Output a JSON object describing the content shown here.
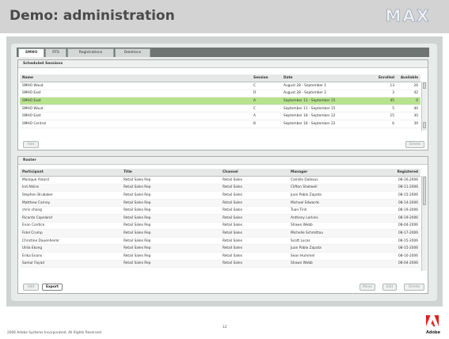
{
  "slide": {
    "title": "Demo: administration",
    "brand": "MAX",
    "footer": "2006 Adobe Systems Incorporated. All Rights Reserved.",
    "page_number": "12",
    "adobe_word": "Adobe",
    "colors": {
      "title_bar": "#d3d3d3",
      "selection": "#b7e28e",
      "adobe_red": "#e0201b"
    }
  },
  "tabs": [
    {
      "label": "SMHO",
      "active": true
    },
    {
      "label": "RTS",
      "active": false
    },
    {
      "label": "Registrations",
      "active": false
    },
    {
      "label": "Deletions",
      "active": false
    }
  ],
  "sessions": {
    "heading": "Scheduled Sessions",
    "columns": [
      "Name",
      "Session",
      "Date",
      "Enrolled",
      "Available"
    ],
    "rows": [
      {
        "name": "SMHO Waud",
        "session": "C",
        "date": "August 28 - September 1",
        "enrolled": "13",
        "available": "26"
      },
      {
        "name": "SMHO East",
        "session": "D",
        "date": "August 28 - September 2",
        "enrolled": "3",
        "available": "42"
      },
      {
        "name": "SMHO East",
        "session": "A",
        "date": "September 11 - September 15",
        "enrolled": "45",
        "available": "0"
      },
      {
        "name": "SMHO Waud",
        "session": "C",
        "date": "September 11 - September 15",
        "enrolled": "5",
        "available": "40"
      },
      {
        "name": "SMHO East",
        "session": "A",
        "date": "September 18 - September 22",
        "enrolled": "15",
        "available": "30"
      },
      {
        "name": "SMHO Central",
        "session": "B",
        "date": "September 18 - September 22",
        "enrolled": "6",
        "available": "39"
      }
    ],
    "selected_index": 2,
    "add_label": "Add",
    "delete_label": "Delete"
  },
  "roster": {
    "heading": "Roster",
    "columns": [
      "Participant",
      "Title",
      "Channel",
      "Manager",
      "Registered"
    ],
    "rows": [
      {
        "participant": "Monique Arkord",
        "title": "Retail Sales Rep",
        "channel": "Retail Sales",
        "manager": "Camille Dalexus",
        "registered": "08-16-2006"
      },
      {
        "participant": "Ind Atkins",
        "title": "Retail Sales Rep",
        "channel": "Retail Sales",
        "manager": "Clifton Shotwell",
        "registered": "08-11-2006"
      },
      {
        "participant": "Stephen Brubaker",
        "title": "Retail Sales Rep",
        "channel": "Retail Sales",
        "manager": "Juan Pablo Zapata",
        "registered": "08-15-2006"
      },
      {
        "participant": "Matthew Carney",
        "title": "Retail Sales Rep",
        "channel": "Retail Sales",
        "manager": "Michael Edwards",
        "registered": "08-14-2006"
      },
      {
        "participant": "chris chong",
        "title": "Retail Sales Rep",
        "channel": "Retail Sales",
        "manager": "Tuan Tinh",
        "registered": "08-19-2006"
      },
      {
        "participant": "Ricardo Copeland",
        "title": "Retail Sales Rep",
        "channel": "Retail Sales",
        "manager": "Anthony Larkins",
        "registered": "08-19-2006"
      },
      {
        "participant": "Evan Cordice",
        "title": "Retail Sales Rep",
        "channel": "Retail Sales",
        "manager": "Shawn Webb",
        "registered": "08-04-2006"
      },
      {
        "participant": "Fidel Crump",
        "title": "Retail Sales Rep",
        "channel": "Retail Sales",
        "manager": "Michelle Schmittou",
        "registered": "08-17-2006"
      },
      {
        "participant": "Christine Dauenheimr",
        "title": "Retail Sales Rep",
        "channel": "Retail Sales",
        "manager": "Scott Lucas",
        "registered": "08-15-2006"
      },
      {
        "participant": "Ulilia Ekong",
        "title": "Retail Sales Rep",
        "channel": "Retail Sales",
        "manager": "Juan Pablo Zapata",
        "registered": "08-15-2006"
      },
      {
        "participant": "Erika Evans",
        "title": "Retail Sales Rep",
        "channel": "Retail Sales",
        "manager": "Sean Hummel",
        "registered": "08-10-2006"
      },
      {
        "participant": "Samar Fayad",
        "title": "Retail Sales Rep",
        "channel": "Retail Sales",
        "manager": "Shawn Webb",
        "registered": "08-04-2006"
      }
    ],
    "add_label": "Add",
    "export_label": "Export",
    "move_label": "Move",
    "edit_label": "Edit",
    "delete_label": "Delete"
  }
}
